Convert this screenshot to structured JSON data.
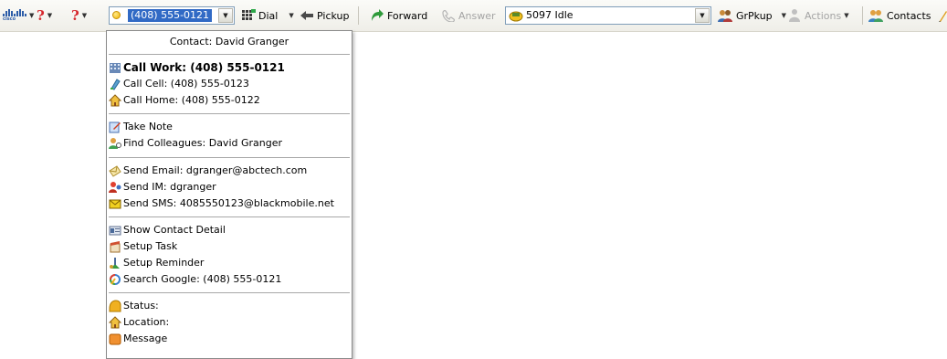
{
  "toolbar": {
    "phone_value": "(408) 555-0121",
    "dial_label": "Dial",
    "pickup_label": "Pickup",
    "forward_label": "Forward",
    "answer_label": "Answer",
    "status_value": "5097 Idle",
    "grpkup_label": "GrPkup",
    "actions_label": "Actions",
    "contacts_label": "Contacts"
  },
  "menu": {
    "header": "Contact: David Granger",
    "call_work": "Call Work: (408) 555-0121",
    "call_cell": "Call Cell: (408) 555-0123",
    "call_home": "Call Home: (408) 555-0122",
    "take_note": "Take Note",
    "find_colleagues": "Find Colleagues: David Granger",
    "send_email": "Send Email: dgranger@abctech.com",
    "send_im": "Send IM: dgranger",
    "send_sms": "Send SMS: 4085550123@blackmobile.net",
    "show_contact": "Show Contact Detail",
    "setup_task": "Setup Task",
    "setup_reminder": "Setup Reminder",
    "search_google": "Search Google: (408) 555-0121",
    "status": "Status:",
    "location": "Location:",
    "message": "Message"
  },
  "colors": {
    "selection": "#316ac5",
    "question_red": "#d6262c",
    "cisco_blue": "#2d5da8"
  },
  "icons": {
    "logo": "cisco-logo",
    "help": "question-icon",
    "presence": "presence-dot-icon",
    "dial": "dial-pad-icon",
    "pickup": "pickup-arrow-icon",
    "forward": "forward-icon",
    "answer": "answer-icon",
    "status": "phone-status-icon",
    "grpkup": "group-pickup-icon",
    "actions": "actions-icon",
    "contacts": "contacts-icon"
  }
}
